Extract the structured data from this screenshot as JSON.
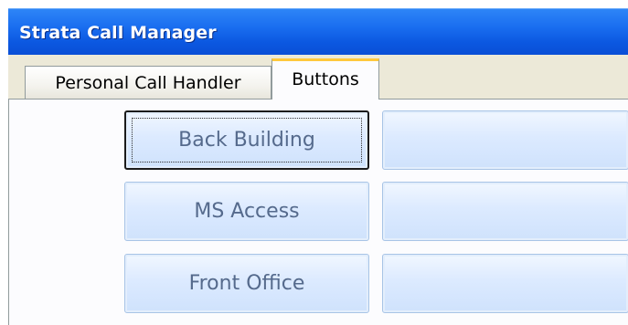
{
  "window": {
    "title": "Strata Call Manager"
  },
  "tabs": [
    {
      "label": "Personal Call Handler",
      "active": false
    },
    {
      "label": "Buttons",
      "active": true
    }
  ],
  "buttons": {
    "left": [
      {
        "label": "Back Building",
        "focused": true
      },
      {
        "label": "MS Access",
        "focused": false
      },
      {
        "label": "Front Office",
        "focused": false
      }
    ],
    "right": [
      {
        "label": ""
      },
      {
        "label": ""
      },
      {
        "label": ""
      }
    ]
  },
  "colors": {
    "titlebar": "#0a4fd6",
    "tab_active_accent": "#ffc83c",
    "button_face": "#dceaff",
    "button_text": "#556a8c"
  }
}
